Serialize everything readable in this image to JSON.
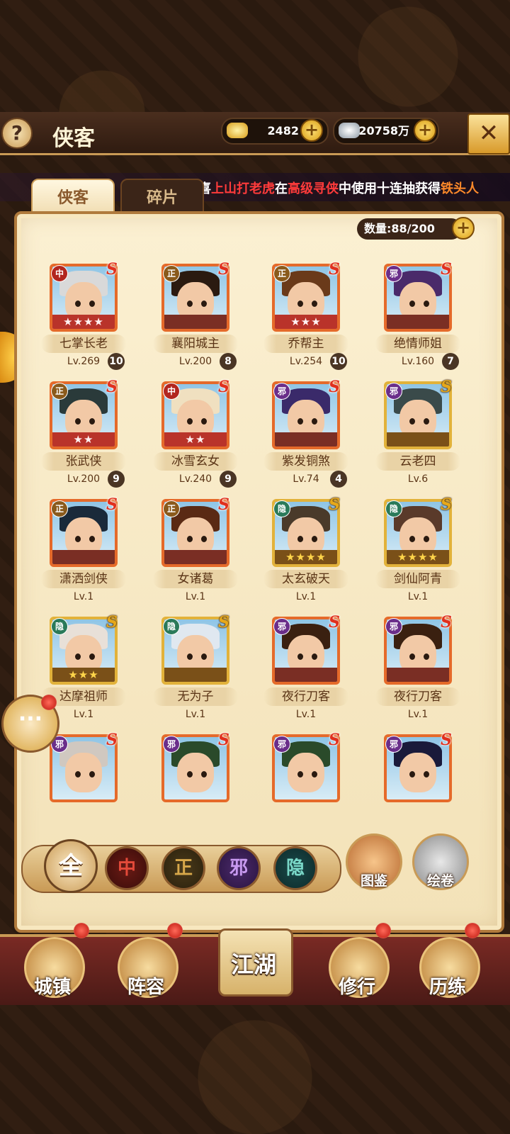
{
  "header": {
    "title": "侠客",
    "gold": "2482",
    "silver": "20758万"
  },
  "marquee": {
    "prefix": "恭喜",
    "player": "上山打老虎",
    "mid": "在",
    "event": "高级寻侠",
    "mid2": "中使用十连抽获得",
    "reward": "铁头人"
  },
  "tabs": [
    "侠客",
    "碎片"
  ],
  "count_label": "数量:88/200",
  "heroes": [
    {
      "name": "七掌长老",
      "faction": "中",
      "grade": "S",
      "stars": "★★★★",
      "lv": "Lv.269",
      "num": "10"
    },
    {
      "name": "襄阳城主",
      "faction": "正",
      "grade": "S",
      "stars": "",
      "lv": "Lv.200",
      "num": "8"
    },
    {
      "name": "乔帮主",
      "faction": "正",
      "grade": "S",
      "stars": "★★★",
      "lv": "Lv.254",
      "num": "10"
    },
    {
      "name": "绝情师姐",
      "faction": "邪",
      "grade": "S",
      "stars": "",
      "lv": "Lv.160",
      "num": "7"
    },
    {
      "name": "张武侠",
      "faction": "正",
      "grade": "S",
      "stars": "★★",
      "lv": "Lv.200",
      "num": "9"
    },
    {
      "name": "冰雪玄女",
      "faction": "中",
      "grade": "S",
      "stars": "★★",
      "lv": "Lv.240",
      "num": "9"
    },
    {
      "name": "紫发铜煞",
      "faction": "邪",
      "grade": "S",
      "stars": "",
      "lv": "Lv.74",
      "num": "4"
    },
    {
      "name": "云老四",
      "faction": "邪",
      "grade": "S",
      "stars": "",
      "lv": "Lv.6",
      "num": ""
    },
    {
      "name": "潇洒剑侠",
      "faction": "正",
      "grade": "S",
      "stars": "",
      "lv": "Lv.1",
      "num": ""
    },
    {
      "name": "女诸葛",
      "faction": "正",
      "grade": "S",
      "stars": "",
      "lv": "Lv.1",
      "num": ""
    },
    {
      "name": "太玄破天",
      "faction": "隐",
      "grade": "S",
      "stars": "★★★★",
      "lv": "Lv.1",
      "num": ""
    },
    {
      "name": "剑仙阿青",
      "faction": "隐",
      "grade": "S",
      "stars": "★★★★",
      "lv": "Lv.1",
      "num": ""
    },
    {
      "name": "达摩祖师",
      "faction": "隐",
      "grade": "S",
      "stars": "★★★",
      "lv": "Lv.1",
      "num": ""
    },
    {
      "name": "无为子",
      "faction": "隐",
      "grade": "S",
      "stars": "",
      "lv": "Lv.1",
      "num": ""
    },
    {
      "name": "夜行刀客",
      "faction": "邪",
      "grade": "S",
      "stars": "",
      "lv": "Lv.1",
      "num": ""
    },
    {
      "name": "夜行刀客",
      "faction": "邪",
      "grade": "S",
      "stars": "",
      "lv": "Lv.1",
      "num": ""
    },
    {
      "name": "",
      "faction": "邪",
      "grade": "S",
      "stars": "",
      "lv": "",
      "num": ""
    },
    {
      "name": "",
      "faction": "邪",
      "grade": "S",
      "stars": "",
      "lv": "",
      "num": ""
    },
    {
      "name": "",
      "faction": "邪",
      "grade": "S",
      "stars": "",
      "lv": "",
      "num": ""
    },
    {
      "name": "",
      "faction": "邪",
      "grade": "S",
      "stars": "",
      "lv": "",
      "num": ""
    }
  ],
  "filters": [
    "全",
    "中",
    "正",
    "邪",
    "隐"
  ],
  "side_buttons": {
    "atlas": "图鉴",
    "scroll": "绘卷"
  },
  "nav": {
    "town": "城镇",
    "lineup": "阵容",
    "jianghu": "江湖",
    "training": "修行",
    "trial": "历练"
  },
  "colors": {
    "red_border": "#e56a2a",
    "gold_border": "#e2b23a",
    "panel": "#fbf0d2"
  }
}
